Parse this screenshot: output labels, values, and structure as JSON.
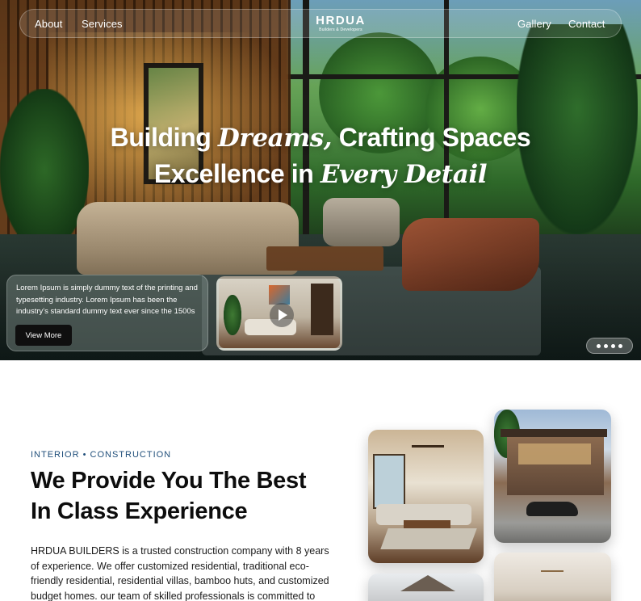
{
  "nav": {
    "left_links": [
      "About",
      "Services"
    ],
    "right_links": [
      "Gallery",
      "Contact"
    ],
    "brand_name": "HRDUA",
    "brand_tagline": "Builders & Developers"
  },
  "hero": {
    "line1_a": "Building ",
    "line1_script": "Dreams,",
    "line1_b": " Crafting Spaces",
    "line2_a": "Excellence in ",
    "line2_script": "Every Detail",
    "info_text": "Lorem Ipsum is simply dummy text of the printing and typesetting industry. Lorem Ipsum has been the industry's standard dummy text ever since the 1500s",
    "cta_label": "View More",
    "video_icon": "play-icon",
    "more_icon": "more-dots-icon"
  },
  "about": {
    "eyebrow": "INTERIOR  •  CONSTRUCTION",
    "title_line1": "We Provide You The Best",
    "title_line2": "In Class Experience",
    "body": "HRDUA BUILDERS is a trusted construction company with 8 years of experience.  We offer customized residential, traditional eco-friendly residential, residential  villas, bamboo huts, and customized budget homes. our team of skilled  professionals is committed to"
  },
  "colors": {
    "eyebrow": "#1f4e7a",
    "cta_bg": "#0f0f0f",
    "text_dark": "#0d0d0d"
  }
}
